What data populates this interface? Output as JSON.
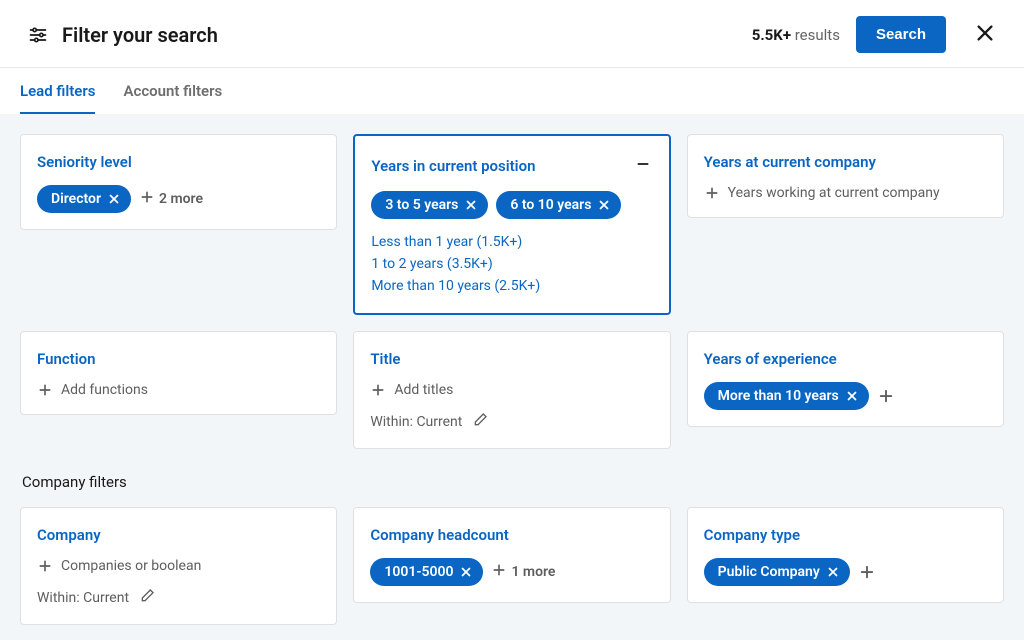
{
  "header": {
    "title": "Filter your search",
    "results_count": "5.5K+",
    "results_label": "results",
    "search_label": "Search"
  },
  "tabs": {
    "lead": "Lead filters",
    "account": "Account filters"
  },
  "seniority": {
    "title": "Seniority level",
    "pills": [
      "Director"
    ],
    "more": "2 more"
  },
  "years_position": {
    "title": "Years in current position",
    "pills": [
      "3 to 5 years",
      "6 to 10 years"
    ],
    "options": [
      "Less than 1 year (1.5K+)",
      "1 to 2 years (3.5K+)",
      "More than 10 years (2.5K+)"
    ]
  },
  "years_company": {
    "title": "Years at current company",
    "placeholder": "Years working at current company"
  },
  "function": {
    "title": "Function",
    "placeholder": "Add functions"
  },
  "title_card": {
    "title": "Title",
    "placeholder": "Add titles",
    "within": "Within: Current"
  },
  "years_experience": {
    "title": "Years of experience",
    "pills": [
      "More than 10 years"
    ]
  },
  "section_company": "Company filters",
  "company": {
    "title": "Company",
    "placeholder": "Companies or boolean",
    "within": "Within: Current"
  },
  "headcount": {
    "title": "Company headcount",
    "pills": [
      "1001-5000"
    ],
    "more": "1 more"
  },
  "company_type": {
    "title": "Company type",
    "pills": [
      "Public Company"
    ]
  }
}
